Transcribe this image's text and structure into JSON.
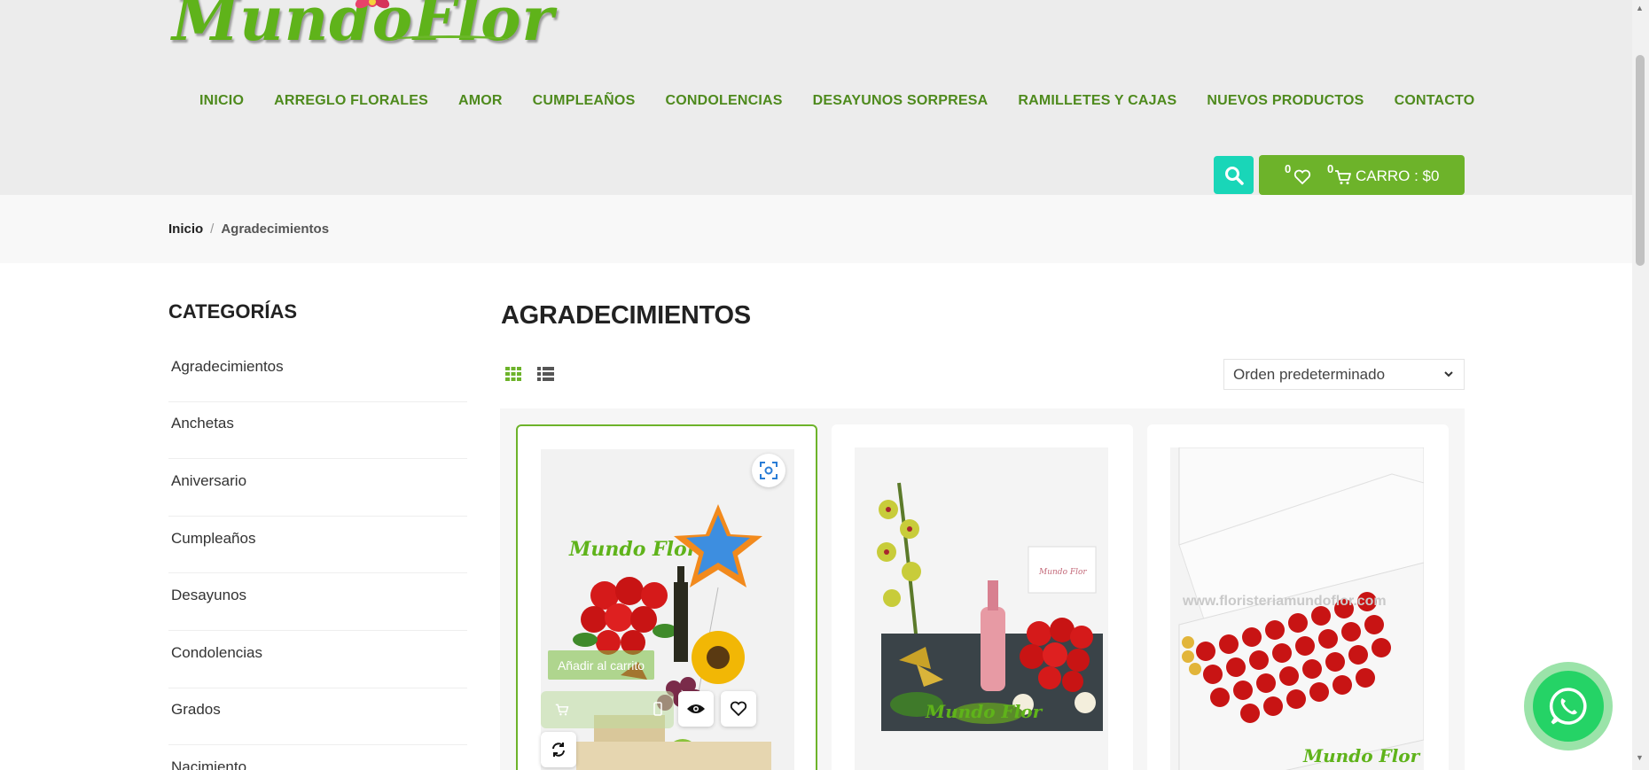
{
  "brand": {
    "name": "MundoFlor"
  },
  "nav": {
    "items": [
      {
        "label": "INICIO"
      },
      {
        "label": "ARREGLO FLORALES"
      },
      {
        "label": "AMOR"
      },
      {
        "label": "CUMPLEAÑOS"
      },
      {
        "label": "CONDOLENCIAS"
      },
      {
        "label": "DESAYUNOS SORPRESA"
      },
      {
        "label": "RAMILLETES Y CAJAS"
      },
      {
        "label": "NUEVOS PRODUCTOS"
      },
      {
        "label": "CONTACTO"
      }
    ]
  },
  "header": {
    "search_icon": "search-icon",
    "wishlist_count": "0",
    "cart_count": "0",
    "cart_label": "CARRO : $0",
    "accent_color": "#6db32a",
    "search_color": "#19d6b8"
  },
  "breadcrumb": {
    "home": "Inicio",
    "separator": "/",
    "current": "Agradecimientos"
  },
  "sidebar": {
    "title": "CATEGORÍAS",
    "items": [
      {
        "label": "Agradecimientos"
      },
      {
        "label": "Anchetas"
      },
      {
        "label": "Aniversario"
      },
      {
        "label": "Cumpleaños"
      },
      {
        "label": "Desayunos"
      },
      {
        "label": "Condolencias"
      },
      {
        "label": "Grados"
      },
      {
        "label": "Nacimiento"
      }
    ]
  },
  "main": {
    "title": "AGRADECIMIENTOS",
    "sort": {
      "selected": "Orden predeterminado"
    },
    "product_actions": {
      "add_to_cart": "Añadir al carrito"
    }
  }
}
